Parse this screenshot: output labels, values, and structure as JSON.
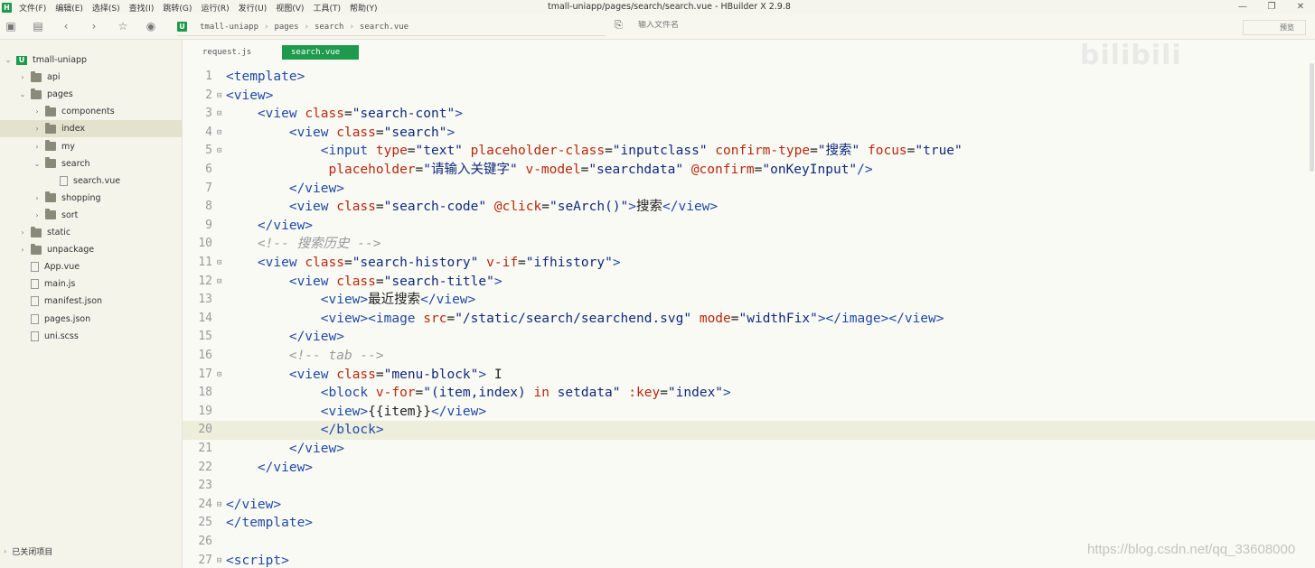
{
  "menu": {
    "items": [
      "文件(F)",
      "编辑(E)",
      "选择(S)",
      "查找(I)",
      "跳转(G)",
      "运行(R)",
      "发行(U)",
      "视图(V)",
      "工具(T)",
      "帮助(Y)"
    ],
    "window_title": "tmall-uniapp/pages/search/search.vue - HBuilder X 2.9.8"
  },
  "toolbar": {
    "breadcrumb": [
      "tmall-uniapp",
      "pages",
      "search",
      "search.vue"
    ],
    "file_search_placeholder": "输入文件名",
    "preview_label": "预览"
  },
  "sidebar": {
    "items": [
      {
        "label": "tmall-uniapp",
        "kind": "project",
        "depth": 0,
        "expanded": true
      },
      {
        "label": "api",
        "kind": "folder",
        "depth": 1,
        "expanded": false
      },
      {
        "label": "pages",
        "kind": "folder",
        "depth": 1,
        "expanded": true
      },
      {
        "label": "components",
        "kind": "folder",
        "depth": 2,
        "expanded": false
      },
      {
        "label": "index",
        "kind": "folder",
        "depth": 2,
        "expanded": false,
        "selected": true
      },
      {
        "label": "my",
        "kind": "folder",
        "depth": 2,
        "expanded": false
      },
      {
        "label": "search",
        "kind": "folder",
        "depth": 2,
        "expanded": true
      },
      {
        "label": "search.vue",
        "kind": "vue",
        "depth": 3
      },
      {
        "label": "shopping",
        "kind": "folder",
        "depth": 2,
        "expanded": false
      },
      {
        "label": "sort",
        "kind": "folder",
        "depth": 2,
        "expanded": false
      },
      {
        "label": "static",
        "kind": "folder",
        "depth": 1,
        "expanded": false
      },
      {
        "label": "unpackage",
        "kind": "folder",
        "depth": 1,
        "expanded": false
      },
      {
        "label": "App.vue",
        "kind": "vue",
        "depth": 1
      },
      {
        "label": "main.js",
        "kind": "js",
        "depth": 1
      },
      {
        "label": "manifest.json",
        "kind": "json",
        "depth": 1
      },
      {
        "label": "pages.json",
        "kind": "json",
        "depth": 1
      },
      {
        "label": "uni.scss",
        "kind": "scss",
        "depth": 1
      }
    ],
    "closed_projects": "已关闭项目"
  },
  "tabs": [
    {
      "label": "request.js",
      "active": false
    },
    {
      "label": "search.vue",
      "active": true
    }
  ],
  "editor": {
    "current_line": 20,
    "lines": [
      {
        "n": "1",
        "fold": false,
        "tokens": [
          [
            "tg",
            "<template>"
          ]
        ]
      },
      {
        "n": "2",
        "fold": true,
        "tokens": [
          [
            "tg",
            "<view>"
          ]
        ]
      },
      {
        "n": "3",
        "fold": true,
        "tokens": [
          [
            "tx",
            "    "
          ],
          [
            "tg",
            "<view "
          ],
          [
            "at",
            "class"
          ],
          [
            "tx",
            "="
          ],
          [
            "st",
            "\"search-cont\""
          ],
          [
            "tg",
            ">"
          ]
        ]
      },
      {
        "n": "4",
        "fold": true,
        "tokens": [
          [
            "tx",
            "        "
          ],
          [
            "tg",
            "<view "
          ],
          [
            "at",
            "class"
          ],
          [
            "tx",
            "="
          ],
          [
            "st",
            "\"search\""
          ],
          [
            "tg",
            ">"
          ]
        ]
      },
      {
        "n": "5",
        "fold": true,
        "tokens": [
          [
            "tx",
            "            "
          ],
          [
            "tg",
            "<input "
          ],
          [
            "at",
            "type"
          ],
          [
            "tx",
            "="
          ],
          [
            "st",
            "\"text\""
          ],
          [
            "tx",
            " "
          ],
          [
            "at",
            "placeholder-class"
          ],
          [
            "tx",
            "="
          ],
          [
            "st",
            "\"inputclass\""
          ],
          [
            "tx",
            " "
          ],
          [
            "at",
            "confirm-type"
          ],
          [
            "tx",
            "="
          ],
          [
            "st",
            "\"搜索\""
          ],
          [
            "tx",
            " "
          ],
          [
            "at",
            "focus"
          ],
          [
            "tx",
            "="
          ],
          [
            "st",
            "\"true\""
          ]
        ]
      },
      {
        "n": "6",
        "fold": false,
        "tokens": [
          [
            "tx",
            "             "
          ],
          [
            "at",
            "placeholder"
          ],
          [
            "tx",
            "="
          ],
          [
            "st",
            "\"请输入关键字\""
          ],
          [
            "tx",
            " "
          ],
          [
            "at",
            "v-model"
          ],
          [
            "tx",
            "="
          ],
          [
            "st",
            "\"searchdata\""
          ],
          [
            "tx",
            " "
          ],
          [
            "at",
            "@confirm"
          ],
          [
            "tx",
            "="
          ],
          [
            "st",
            "\"onKeyInput\""
          ],
          [
            "tg",
            "/>"
          ]
        ]
      },
      {
        "n": "7",
        "fold": false,
        "tokens": [
          [
            "tx",
            "        "
          ],
          [
            "tg",
            "</view>"
          ]
        ]
      },
      {
        "n": "8",
        "fold": false,
        "tokens": [
          [
            "tx",
            "        "
          ],
          [
            "tg",
            "<view "
          ],
          [
            "at",
            "class"
          ],
          [
            "tx",
            "="
          ],
          [
            "st",
            "\"search-code\""
          ],
          [
            "tx",
            " "
          ],
          [
            "at",
            "@click"
          ],
          [
            "tx",
            "="
          ],
          [
            "st",
            "\"seArch()\""
          ],
          [
            "tg",
            ">"
          ],
          [
            "tx",
            "搜索"
          ],
          [
            "tg",
            "</view>"
          ]
        ]
      },
      {
        "n": "9",
        "fold": false,
        "tokens": [
          [
            "tx",
            "    "
          ],
          [
            "tg",
            "</view>"
          ]
        ]
      },
      {
        "n": "10",
        "fold": false,
        "tokens": [
          [
            "tx",
            "    "
          ],
          [
            "cm",
            "<!-- 搜索历史 -->"
          ]
        ]
      },
      {
        "n": "11",
        "fold": true,
        "tokens": [
          [
            "tx",
            "    "
          ],
          [
            "tg",
            "<view "
          ],
          [
            "at",
            "class"
          ],
          [
            "tx",
            "="
          ],
          [
            "st",
            "\"search-history\""
          ],
          [
            "tx",
            " "
          ],
          [
            "at",
            "v-if"
          ],
          [
            "tx",
            "="
          ],
          [
            "st",
            "\"ifhistory\""
          ],
          [
            "tg",
            ">"
          ]
        ]
      },
      {
        "n": "12",
        "fold": true,
        "tokens": [
          [
            "tx",
            "        "
          ],
          [
            "tg",
            "<view "
          ],
          [
            "at",
            "class"
          ],
          [
            "tx",
            "="
          ],
          [
            "st",
            "\"search-title\""
          ],
          [
            "tg",
            ">"
          ]
        ]
      },
      {
        "n": "13",
        "fold": false,
        "tokens": [
          [
            "tx",
            "            "
          ],
          [
            "tg",
            "<view>"
          ],
          [
            "tx",
            "最近搜索"
          ],
          [
            "tg",
            "</view>"
          ]
        ]
      },
      {
        "n": "14",
        "fold": false,
        "tokens": [
          [
            "tx",
            "            "
          ],
          [
            "tg",
            "<view><image "
          ],
          [
            "at",
            "src"
          ],
          [
            "tx",
            "="
          ],
          [
            "st",
            "\"/static/search/searchend.svg\""
          ],
          [
            "tx",
            " "
          ],
          [
            "at",
            "mode"
          ],
          [
            "tx",
            "="
          ],
          [
            "st",
            "\"widthFix\""
          ],
          [
            "tg",
            "></image></view>"
          ]
        ]
      },
      {
        "n": "15",
        "fold": false,
        "tokens": [
          [
            "tx",
            "        "
          ],
          [
            "tg",
            "</view>"
          ]
        ]
      },
      {
        "n": "16",
        "fold": false,
        "tokens": [
          [
            "tx",
            "        "
          ],
          [
            "cm",
            "<!-- tab -->"
          ]
        ]
      },
      {
        "n": "17",
        "fold": true,
        "tokens": [
          [
            "tx",
            "        "
          ],
          [
            "tg",
            "<view "
          ],
          [
            "at",
            "class"
          ],
          [
            "tx",
            "="
          ],
          [
            "st",
            "\"menu-block\""
          ],
          [
            "tg",
            ">"
          ],
          [
            "tx",
            " I"
          ]
        ]
      },
      {
        "n": "18",
        "fold": false,
        "tokens": [
          [
            "tx",
            "            "
          ],
          [
            "tg",
            "<block "
          ],
          [
            "at",
            "v-for"
          ],
          [
            "tx",
            "="
          ],
          [
            "st",
            "\"(item,index) "
          ],
          [
            "at",
            "in"
          ],
          [
            "st",
            " setdata\""
          ],
          [
            "tx",
            " "
          ],
          [
            "at",
            ":key"
          ],
          [
            "tx",
            "="
          ],
          [
            "st",
            "\"index\""
          ],
          [
            "tg",
            ">"
          ]
        ]
      },
      {
        "n": "19",
        "fold": false,
        "tokens": [
          [
            "tx",
            "            "
          ],
          [
            "tg",
            "<view>"
          ],
          [
            "tx",
            "{{item}}"
          ],
          [
            "tg",
            "</view>"
          ]
        ]
      },
      {
        "n": "20",
        "fold": false,
        "tokens": [
          [
            "tx",
            "            "
          ],
          [
            "tg",
            "</block>"
          ]
        ]
      },
      {
        "n": "21",
        "fold": false,
        "tokens": [
          [
            "tx",
            "        "
          ],
          [
            "tg",
            "</view>"
          ]
        ]
      },
      {
        "n": "22",
        "fold": false,
        "tokens": [
          [
            "tx",
            "    "
          ],
          [
            "tg",
            "</view>"
          ]
        ]
      },
      {
        "n": "23",
        "fold": false,
        "tokens": []
      },
      {
        "n": "24",
        "fold": true,
        "tokens": [
          [
            "tg",
            "</view>"
          ]
        ]
      },
      {
        "n": "25",
        "fold": false,
        "tokens": [
          [
            "tg",
            "</template>"
          ]
        ]
      },
      {
        "n": "26",
        "fold": false,
        "tokens": []
      },
      {
        "n": "27",
        "fold": true,
        "tokens": [
          [
            "tg",
            "<script>"
          ]
        ]
      }
    ]
  },
  "watermark": "bilibili",
  "url_watermark": "https://blog.csdn.net/qq_33608000",
  "colors": {
    "accent": "#1d9a4c",
    "tag": "#1f4aa8",
    "attr": "#b8270e",
    "string": "#0e2a7d",
    "comment": "#999999"
  }
}
